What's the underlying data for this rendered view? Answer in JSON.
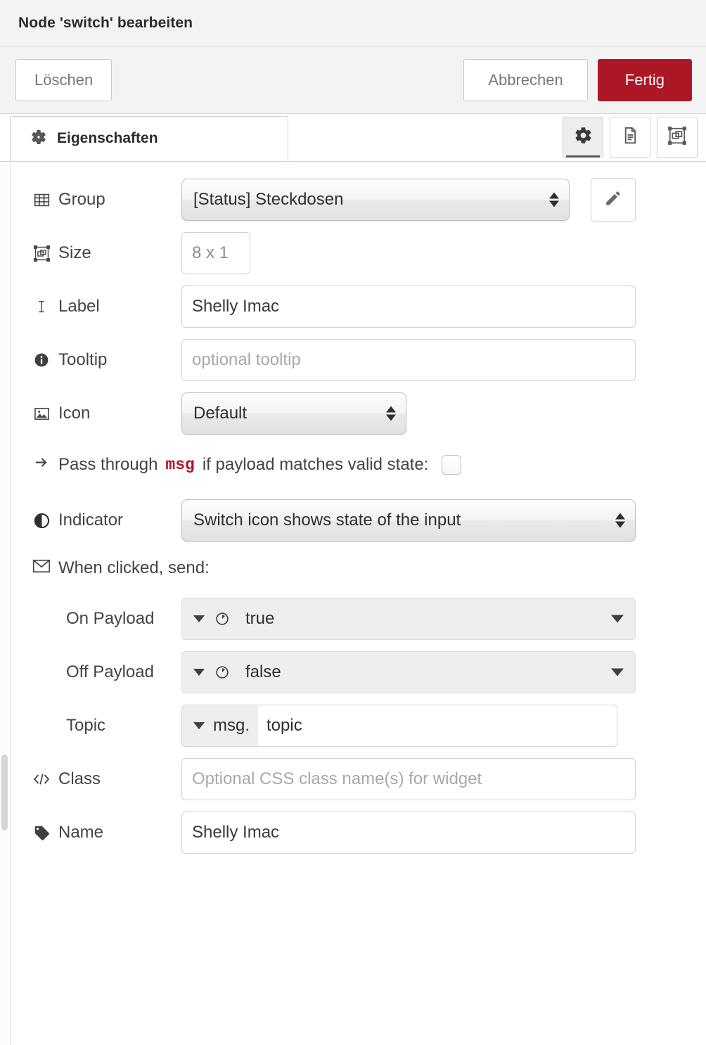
{
  "dialog": {
    "title": "Node 'switch' bearbeiten",
    "buttons": {
      "delete": "Löschen",
      "cancel": "Abbrechen",
      "done": "Fertig"
    },
    "done_color": "#AD1625"
  },
  "tabs": {
    "active": "Eigenschaften",
    "items": [
      {
        "label": "Eigenschaften",
        "icon": "gear-icon"
      }
    ],
    "tools": [
      {
        "name": "properties-gear-button",
        "icon": "gear-icon",
        "active": true
      },
      {
        "name": "description-button",
        "icon": "document-icon",
        "active": false
      },
      {
        "name": "appearance-button",
        "icon": "appearance-icon",
        "active": false
      }
    ]
  },
  "form": {
    "group": {
      "label": "Group",
      "icon": "table-icon",
      "value": "[Status] Steckdosen",
      "edit_button_icon": "pencil-icon"
    },
    "size": {
      "label": "Size",
      "icon": "resize-icon",
      "value": "8 x 1"
    },
    "label_field": {
      "label": "Label",
      "icon": "text-cursor-icon",
      "value": "Shelly Imac"
    },
    "tooltip": {
      "label": "Tooltip",
      "icon": "info-icon",
      "value": "",
      "placeholder": "optional tooltip"
    },
    "icon_field": {
      "label": "Icon",
      "icon": "image-icon",
      "value": "Default"
    },
    "passthrough": {
      "icon": "arrow-right-icon",
      "text_before": "Pass through",
      "code": "msg",
      "text_after": "if payload matches valid state:",
      "checked": false
    },
    "indicator": {
      "label": "Indicator",
      "icon": "adjust-icon",
      "value": "Switch icon shows state of the input"
    },
    "when_clicked": {
      "label": "When clicked, send:",
      "icon": "envelope-icon"
    },
    "on_payload": {
      "label": "On Payload",
      "type_icon": "boolean-type-icon",
      "value": "true"
    },
    "off_payload": {
      "label": "Off Payload",
      "type_icon": "boolean-type-icon",
      "value": "false"
    },
    "topic": {
      "label": "Topic",
      "prefix": "msg.",
      "value": "topic"
    },
    "class_field": {
      "label": "Class",
      "icon": "code-icon",
      "value": "",
      "placeholder": "Optional CSS class name(s) for widget"
    },
    "name_field": {
      "label": "Name",
      "icon": "tag-icon",
      "value": "Shelly Imac"
    }
  }
}
